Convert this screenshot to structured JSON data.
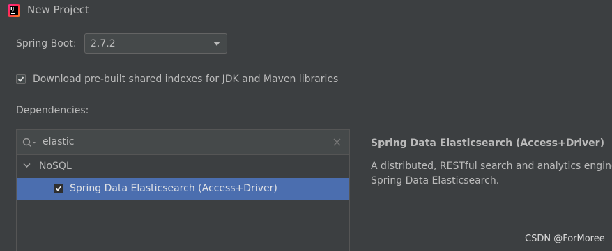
{
  "window": {
    "title": "New Project",
    "app_icon": "intellij-idea-icon"
  },
  "spring_boot": {
    "label": "Spring Boot:",
    "selected_version": "2.7.2"
  },
  "shared_indexes": {
    "label": "Download pre-built shared indexes for JDK and Maven libraries",
    "checked": true
  },
  "dependencies": {
    "label": "Dependencies:",
    "search": {
      "value": "elastic",
      "icon": "search-icon",
      "clear_icon": "close-icon"
    },
    "groups": [
      {
        "name": "NoSQL",
        "expanded": true,
        "items": [
          {
            "label": "Spring Data Elasticsearch (Access+Driver)",
            "checked": true,
            "selected": true
          }
        ]
      }
    ]
  },
  "details": {
    "title": "Spring Data Elasticsearch (Access+Driver)",
    "description_line1": "A distributed, RESTful search and analytics engine with",
    "description_line2": "Spring Data Elasticsearch."
  },
  "watermark": "CSDN @ForMoree",
  "colors": {
    "background": "#3c3f41",
    "selection": "#4b6eaf",
    "text": "#bbbbbb"
  }
}
